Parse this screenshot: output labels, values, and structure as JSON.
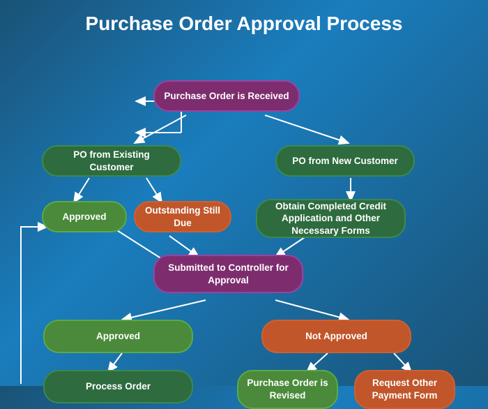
{
  "title": "Purchase Order Approval Process",
  "nodes": {
    "purchase_order_received": "Purchase Order is Received",
    "po_existing_customer": "PO from Existing Customer",
    "po_new_customer": "PO from New Customer",
    "approved_left": "Approved",
    "outstanding_still_due": "Outstanding Still Due",
    "obtain_credit": "Obtain Completed Credit Application and Other Necessary Forms",
    "submitted_controller": "Submitted to Controller for Approval",
    "approved_bottom": "Approved",
    "not_approved": "Not Approved",
    "process_order": "Process Order",
    "purchase_order_revised": "Purchase Order is Revised",
    "request_other_payment": "Request Other Payment Form"
  }
}
